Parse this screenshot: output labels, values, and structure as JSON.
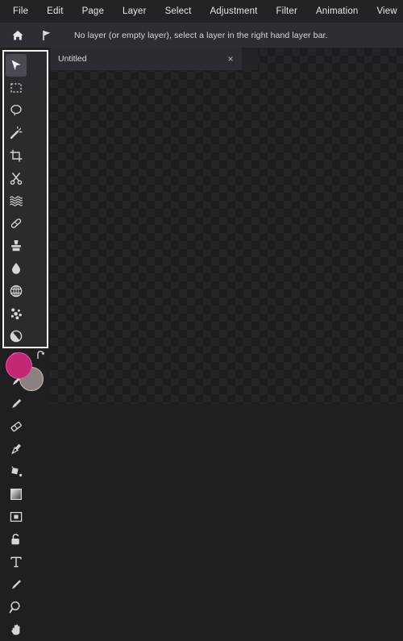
{
  "app": {
    "accent_color": "#c42775",
    "background_color": "#1f1f22",
    "panel_color": "#2a2a2f",
    "menubar_color": "#232327",
    "statusbar_color": "#2d2d33"
  },
  "menubar": {
    "items": [
      {
        "label": "File",
        "name": "menu-file"
      },
      {
        "label": "Edit",
        "name": "menu-edit"
      },
      {
        "label": "Page",
        "name": "menu-page"
      },
      {
        "label": "Layer",
        "name": "menu-layer"
      },
      {
        "label": "Select",
        "name": "menu-select"
      },
      {
        "label": "Adjustment",
        "name": "menu-adjustment"
      },
      {
        "label": "Filter",
        "name": "menu-filter"
      },
      {
        "label": "Animation",
        "name": "menu-animation"
      },
      {
        "label": "View",
        "name": "menu-view"
      }
    ]
  },
  "statusbar": {
    "home_icon": "home-icon",
    "flag_icon": "flag-icon",
    "message": "No layer (or empty layer), select a layer in the right hand layer bar."
  },
  "tabs": {
    "items": [
      {
        "label": "Untitled",
        "close": "×",
        "active": true
      }
    ]
  },
  "tools": {
    "items": [
      {
        "name": "move-select-tool",
        "icon": "arrow-cursor-icon",
        "active": true
      },
      {
        "name": "rectangle-select-tool",
        "icon": "marquee-icon",
        "active": false
      },
      {
        "name": "lasso-select-tool",
        "icon": "lasso-icon",
        "active": false
      },
      {
        "name": "magic-wand-tool",
        "icon": "magic-wand-icon",
        "active": false
      },
      {
        "name": "crop-tool",
        "icon": "crop-icon",
        "active": false
      },
      {
        "name": "scissors-tool",
        "icon": "scissors-icon",
        "active": false
      },
      {
        "name": "smudge-tool",
        "icon": "waves-icon",
        "active": false
      },
      {
        "name": "heal-tool",
        "icon": "bandage-icon",
        "active": false
      },
      {
        "name": "clone-stamp-tool",
        "icon": "stamp-icon",
        "active": false
      },
      {
        "name": "blur-tool",
        "icon": "droplet-icon",
        "active": false
      },
      {
        "name": "sphere-map-tool",
        "icon": "globe-icon",
        "active": false
      },
      {
        "name": "scatter-tool",
        "icon": "particles-icon",
        "active": false
      },
      {
        "name": "dodge-burn-tool",
        "icon": "contrast-circle-icon",
        "active": false
      },
      {
        "name": "ripple-tool",
        "icon": "radial-rings-icon",
        "active": false
      },
      {
        "name": "pencil-tool",
        "icon": "pencil-icon",
        "active": false
      },
      {
        "name": "brush-tool",
        "icon": "brush-icon",
        "active": false
      },
      {
        "name": "eraser-tool",
        "icon": "eraser-icon",
        "active": false
      },
      {
        "name": "paintbrush-tool",
        "icon": "paintbrush-icon",
        "active": false
      },
      {
        "name": "paint-bucket-tool",
        "icon": "paint-bucket-icon",
        "active": false
      },
      {
        "name": "gradient-tool",
        "icon": "gradient-square-icon",
        "active": false
      },
      {
        "name": "shape-frame-tool",
        "icon": "framed-shape-icon",
        "active": false
      },
      {
        "name": "lock-tool",
        "icon": "padlock-icon",
        "active": false
      },
      {
        "name": "text-tool",
        "icon": "text-t-icon",
        "active": false
      },
      {
        "name": "eyedropper-tool",
        "icon": "eyedropper-icon",
        "active": false
      },
      {
        "name": "zoom-tool",
        "icon": "magnifier-icon",
        "active": false
      },
      {
        "name": "pan-tool",
        "icon": "hand-icon",
        "active": false
      }
    ]
  },
  "swatches": {
    "foreground_color": "#c42775",
    "background_color": "#8d8080",
    "swap_icon": "swap-arrow-icon"
  }
}
